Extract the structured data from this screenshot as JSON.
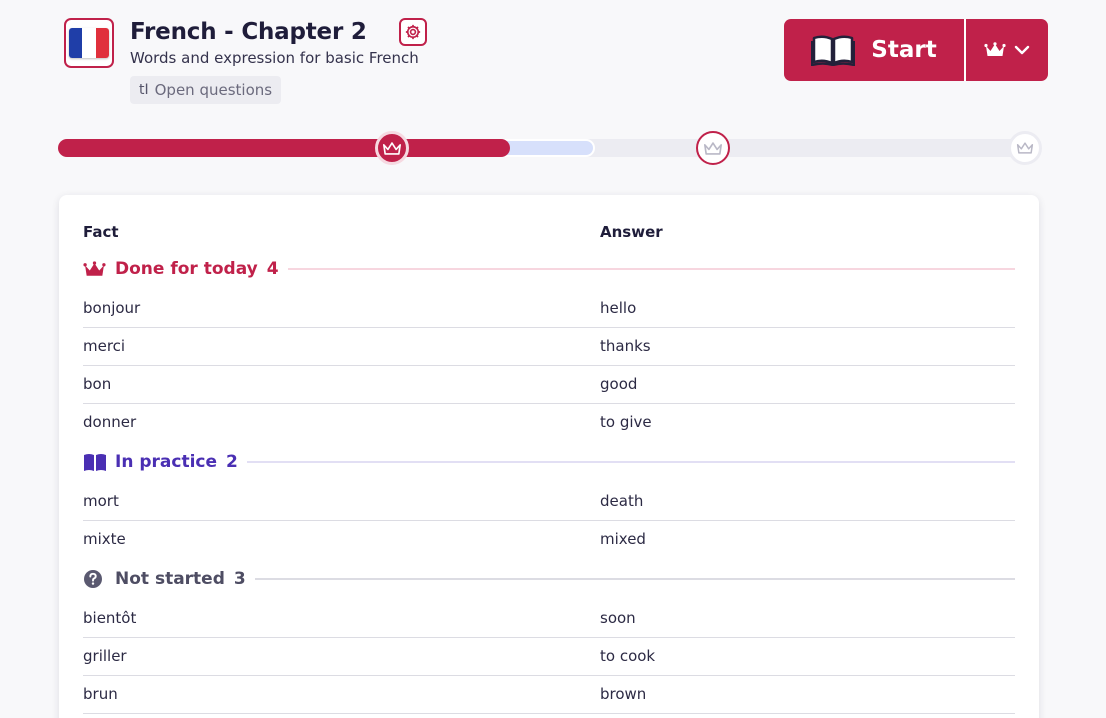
{
  "header": {
    "title": "French - Chapter 2",
    "subtitle": "Words and expression for basic French",
    "chip_icon": "tI",
    "chip_label": "Open questions",
    "start_label": "Start"
  },
  "colors": {
    "accent": "#c0214a",
    "practice": "#4a2fb3",
    "not_started": "#5a5970"
  },
  "progress": {
    "done_fraction": 0.46,
    "practice_fraction": 0.547
  },
  "table": {
    "fact_header": "Fact",
    "answer_header": "Answer",
    "sections": [
      {
        "label": "Done for today",
        "count": "4",
        "icon": "crown-icon",
        "rows": [
          {
            "fact": "bonjour",
            "answer": "hello"
          },
          {
            "fact": "merci",
            "answer": "thanks"
          },
          {
            "fact": "bon",
            "answer": "good"
          },
          {
            "fact": "donner",
            "answer": "to give"
          }
        ]
      },
      {
        "label": "In practice",
        "count": "2",
        "icon": "book-icon",
        "rows": [
          {
            "fact": "mort",
            "answer": "death"
          },
          {
            "fact": "mixte",
            "answer": "mixed"
          }
        ]
      },
      {
        "label": "Not started",
        "count": "3",
        "icon": "question-icon",
        "rows": [
          {
            "fact": "bientôt",
            "answer": "soon"
          },
          {
            "fact": "griller",
            "answer": "to cook"
          },
          {
            "fact": "brun",
            "answer": "brown"
          }
        ]
      }
    ]
  }
}
